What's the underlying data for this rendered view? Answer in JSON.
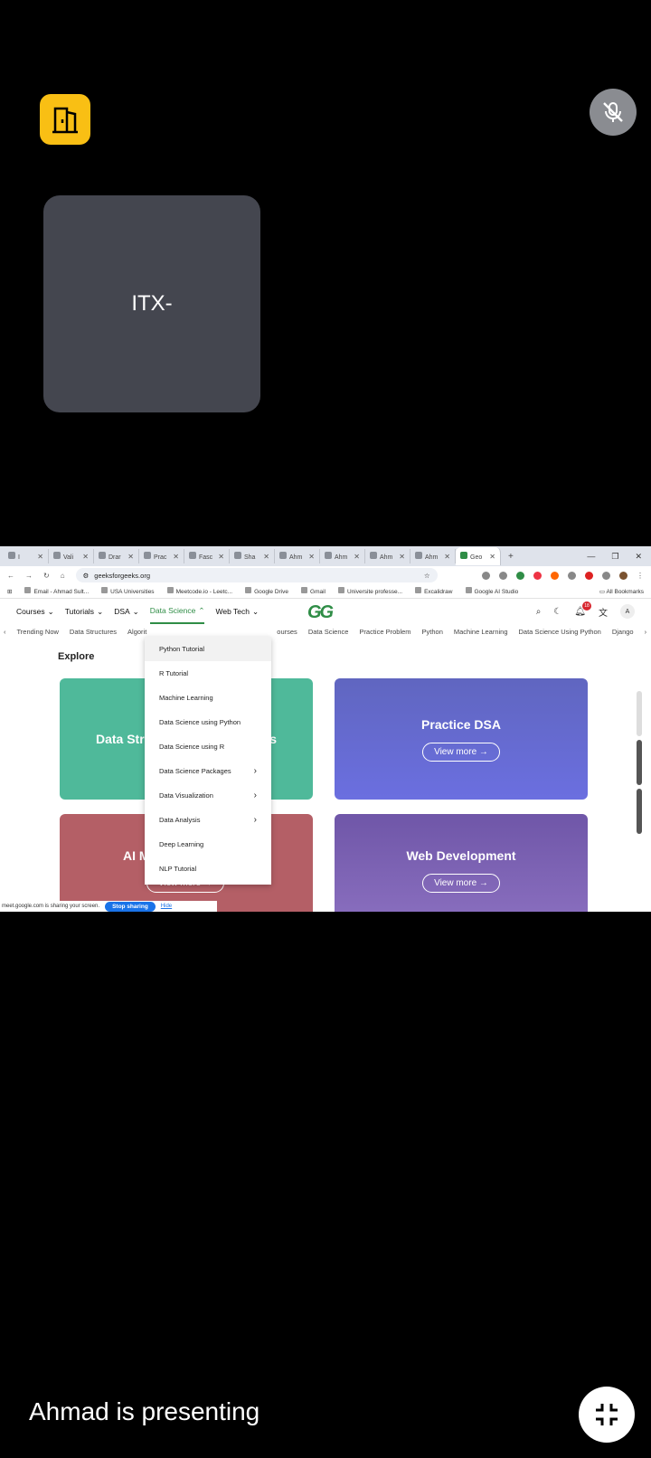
{
  "participant": {
    "name": "ITX-"
  },
  "presenter_text": "Ahmad is presenting",
  "screen": {
    "tabs": [
      "I",
      "Vali",
      "Drar",
      "Prac",
      "Fasc",
      "Sha",
      "Ahm",
      "Ahm",
      "Ahm",
      "Ahm",
      "Geo"
    ],
    "url": "geeksforgeeks.org",
    "bookmarks": [
      "Email - Ahmad Sult...",
      "USA Universities",
      "Meetcode.io - Leetc...",
      "Google Drive",
      "Gmail",
      "Universite professe...",
      "Excalidraw",
      "Google AI Studio"
    ],
    "all_bookmarks": "All Bookmarks",
    "nav": [
      "Courses",
      "Tutorials",
      "DSA",
      "Data Science",
      "Web Tech"
    ],
    "notification_count": "18",
    "avatar_letter": "A",
    "trending": [
      "Trending Now",
      "Data Structures",
      "Algorit",
      "ourses",
      "Data Science",
      "Practice Problem",
      "Python",
      "Machine Learning",
      "Data Science Using Python",
      "Django"
    ],
    "explore": "Explore",
    "cards": {
      "ds_title": "Data Stru",
      "ds_title_tail": "s",
      "pdsa_title": "Practice DSA",
      "ai_title": "AI M",
      "web_title": "Web Development",
      "view_more": "View more →"
    },
    "dropdown": [
      "Python Tutorial",
      "R Tutorial",
      "Machine Learning",
      "Data Science using Python",
      "Data Science using R",
      "Data Science Packages",
      "Data Visualization",
      "Data Analysis",
      "Deep Learning",
      "NLP Tutorial"
    ],
    "share_text": "meet.google.com is sharing your screen.",
    "stop_sharing": "Stop sharing",
    "hide": "Hide"
  }
}
